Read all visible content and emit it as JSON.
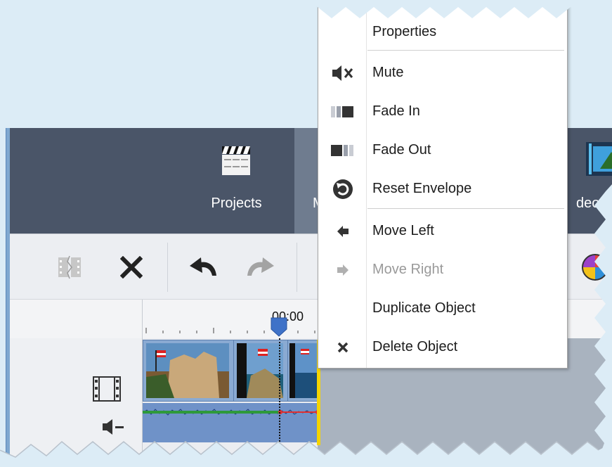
{
  "header_tabs": [
    {
      "label": "Projects",
      "icon": "clapperboard-icon"
    },
    {
      "label": "M",
      "icon": ""
    },
    {
      "label": "deo F",
      "icon": "film-strip-icon"
    }
  ],
  "ruler": {
    "time": "00:00"
  },
  "context_menu": {
    "items": [
      {
        "label": "Properties",
        "icon": "",
        "enabled": true
      },
      {
        "label": "Mute",
        "icon": "mute-icon",
        "enabled": true
      },
      {
        "label": "Fade In",
        "icon": "fade-in-icon",
        "enabled": true
      },
      {
        "label": "Fade Out",
        "icon": "fade-out-icon",
        "enabled": true
      },
      {
        "label": "Reset Envelope",
        "icon": "reset-envelope-icon",
        "enabled": true
      },
      {
        "label": "Move Left",
        "icon": "move-left-icon",
        "enabled": true
      },
      {
        "label": "Move Right",
        "icon": "move-right-icon",
        "enabled": false
      },
      {
        "label": "Duplicate Object",
        "icon": "",
        "enabled": true
      },
      {
        "label": "Delete Object",
        "icon": "delete-icon",
        "enabled": true
      }
    ]
  },
  "colors": {
    "header_bg": "#4a5568",
    "toolbar_bg": "#eceef2",
    "clip_blue": "#6f92c8",
    "playhead_marker": "#3f72c8",
    "audio_wave": "#2e9a3a",
    "envelope_red": "#e03030",
    "marker_yellow": "#f5d400"
  }
}
